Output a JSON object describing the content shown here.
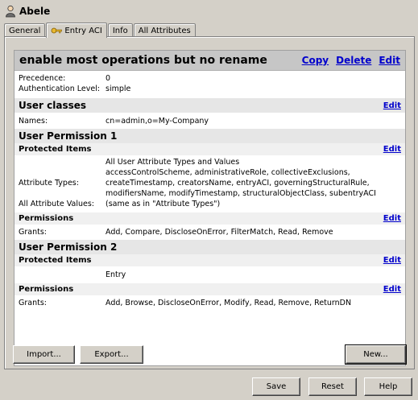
{
  "window": {
    "title": "Abele"
  },
  "tabs": [
    {
      "label": "General"
    },
    {
      "label": "Entry ACI"
    },
    {
      "label": "Info"
    },
    {
      "label": "All Attributes"
    }
  ],
  "aci": {
    "title": "enable most operations but no rename",
    "links": {
      "copy": "Copy",
      "delete": "Delete",
      "edit": "Edit"
    },
    "precedence_label": "Precedence:",
    "precedence_value": "0",
    "auth_label": "Authentication Level:",
    "auth_value": "simple"
  },
  "user_classes": {
    "heading": "User classes",
    "edit": "Edit",
    "names_label": "Names:",
    "names_value": "cn=admin,o=My-Company"
  },
  "perm1": {
    "heading": "User Permission 1",
    "protected_heading": "Protected Items",
    "protected_edit": "Edit",
    "all_user_attr": "All User Attribute Types and Values",
    "attr_types_label": "Attribute Types:",
    "attr_types_lines": [
      "accessControlScheme, administrativeRole, collectiveExclusions,",
      "createTimestamp, creatorsName, entryACI, governingStructuralRule,",
      "modifiersName, modifyTimestamp, structuralObjectClass, subentryACI"
    ],
    "all_values_label": "All Attribute Values:",
    "all_values_value": "(same as in \"Attribute Types\")",
    "permissions_heading": "Permissions",
    "permissions_edit": "Edit",
    "grants_label": "Grants:",
    "grants_value": "Add, Compare, DiscloseOnError, FilterMatch, Read, Remove"
  },
  "perm2": {
    "heading": "User Permission 2",
    "protected_heading": "Protected Items",
    "protected_edit": "Edit",
    "entry": "Entry",
    "permissions_heading": "Permissions",
    "permissions_edit": "Edit",
    "grants_label": "Grants:",
    "grants_value": "Add, Browse, DiscloseOnError, Modify, Read, Remove, ReturnDN"
  },
  "panel_buttons": {
    "import": "Import...",
    "export": "Export...",
    "new": "New..."
  },
  "footer_buttons": {
    "save": "Save",
    "reset": "Reset",
    "help": "Help"
  }
}
